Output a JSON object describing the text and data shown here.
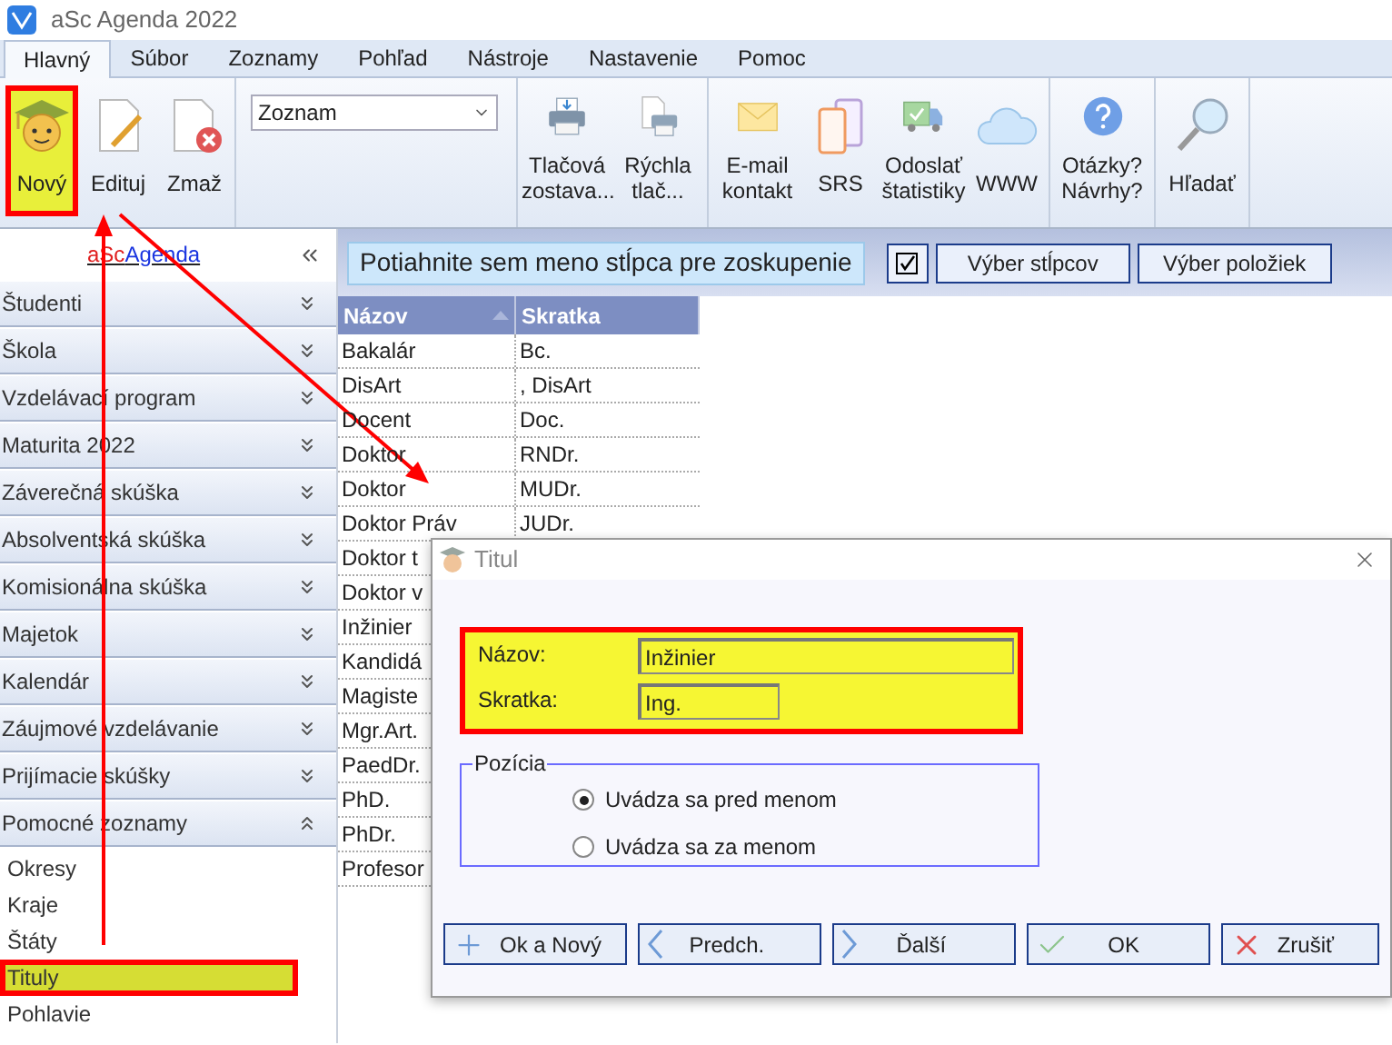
{
  "window": {
    "title": "aSc Agenda 2022"
  },
  "menu_tabs": [
    {
      "label": "Hlavný",
      "selected": true
    },
    {
      "label": "Súbor",
      "selected": false
    },
    {
      "label": "Zoznamy",
      "selected": false
    },
    {
      "label": "Pohľad",
      "selected": false
    },
    {
      "label": "Nástroje",
      "selected": false
    },
    {
      "label": "Nastavenie",
      "selected": false
    },
    {
      "label": "Pomoc",
      "selected": false
    }
  ],
  "ribbon": {
    "groups": [
      {
        "buttons": [
          {
            "label": "Nový",
            "highlighted": true
          },
          {
            "label": "Edituj",
            "highlighted": false
          },
          {
            "label": "Zmaž",
            "highlighted": false
          }
        ]
      },
      {
        "dropdown": {
          "value": "Zoznam"
        }
      },
      {
        "buttons": [
          {
            "label": "Tlačová zostava...",
            "highlighted": false
          },
          {
            "label": "Rýchla tlač...",
            "highlighted": false
          }
        ]
      },
      {
        "buttons": [
          {
            "label": "E-mail kontakt",
            "highlighted": false
          },
          {
            "label": "SRS",
            "highlighted": false
          },
          {
            "label": "Odoslať štatistiky",
            "highlighted": false
          },
          {
            "label": "WWW",
            "highlighted": false
          }
        ]
      },
      {
        "buttons": [
          {
            "label": "Otázky? Návrhy?",
            "highlighted": false
          }
        ]
      },
      {
        "buttons": [
          {
            "label": "Hľadať",
            "highlighted": false
          }
        ]
      }
    ]
  },
  "sidebar": {
    "link": {
      "prefix": "aSc",
      "name": "Agenda"
    },
    "sections": [
      {
        "label": "Študenti",
        "expanded": false
      },
      {
        "label": "Škola",
        "expanded": false
      },
      {
        "label": "Vzdelávací program",
        "expanded": false
      },
      {
        "label": "Maturita 2022",
        "expanded": false
      },
      {
        "label": "Záverečná skúška",
        "expanded": false
      },
      {
        "label": "Absolventská skúška",
        "expanded": false
      },
      {
        "label": "Komisionálna skúška",
        "expanded": false
      },
      {
        "label": "Majetok",
        "expanded": false
      },
      {
        "label": "Kalendár",
        "expanded": false
      },
      {
        "label": "Záujmové vzdelávanie",
        "expanded": false
      },
      {
        "label": "Prijímacie skúšky",
        "expanded": false
      },
      {
        "label": "Pomocné zoznamy",
        "expanded": true
      }
    ],
    "items": [
      {
        "label": "Okresy",
        "selected": false
      },
      {
        "label": "Kraje",
        "selected": false
      },
      {
        "label": "Štáty",
        "selected": false
      },
      {
        "label": "Tituly",
        "selected": true
      },
      {
        "label": "Pohlavie",
        "selected": false
      }
    ]
  },
  "grid": {
    "group_hint": "Potiahnite sem meno stĺpca pre zoskupenie",
    "toolbar_buttons": [
      "Výber stĺpcov",
      "Výber položiek"
    ],
    "columns": [
      {
        "label": "Názov",
        "sorted": true
      },
      {
        "label": "Skratka",
        "sorted": false
      }
    ],
    "rows": [
      [
        "Bakalár",
        "Bc."
      ],
      [
        "DisArt",
        ", DisArt"
      ],
      [
        "Docent",
        "Doc."
      ],
      [
        "Doktor",
        "RNDr."
      ],
      [
        "Doktor",
        "MUDr."
      ],
      [
        "Doktor Práv",
        "JUDr."
      ],
      [
        "Doktor t"
      ],
      [
        "Doktor v"
      ],
      [
        "Inžinier"
      ],
      [
        "Kandidá"
      ],
      [
        "Magiste"
      ],
      [
        "Mgr.Art."
      ],
      [
        "PaedDr."
      ],
      [
        "PhD."
      ],
      [
        "PhDr."
      ],
      [
        "Profesor"
      ]
    ]
  },
  "dialog": {
    "title": "Titul",
    "fields_highlighted": true,
    "fields": [
      {
        "label": "Názov:",
        "value": "Inžinier"
      },
      {
        "label": "Skratka:",
        "value": "Ing."
      }
    ],
    "position": {
      "legend": "Pozícia",
      "options": [
        {
          "label": "Uvádza sa pred menom",
          "selected": true
        },
        {
          "label": "Uvádza sa za menom",
          "selected": false
        }
      ]
    },
    "buttons": [
      "Ok a Nový",
      "Predch.",
      "Ďalší",
      "OK",
      "Zrušiť"
    ]
  }
}
